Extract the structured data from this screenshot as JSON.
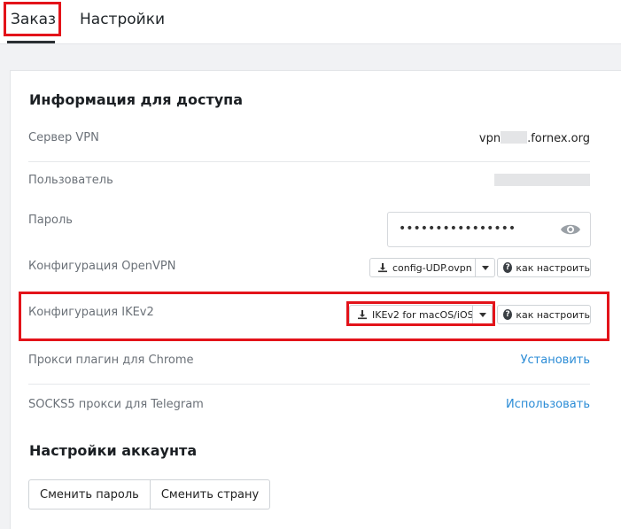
{
  "tabs": [
    {
      "label": "Заказ",
      "active": true
    },
    {
      "label": "Настройки",
      "active": false
    }
  ],
  "access": {
    "title": "Информация для доступа",
    "server": {
      "label": "Сервер VPN",
      "value_prefix": "vpn",
      "value_suffix": ".fornex.org"
    },
    "user": {
      "label": "Пользователь"
    },
    "password": {
      "label": "Пароль",
      "masked": "••••••••••••••••"
    },
    "openvpn": {
      "label": "Конфигурация OpenVPN",
      "file": "config-UDP.ovpn",
      "help": "как настроить"
    },
    "ikev2": {
      "label": "Конфигурация IKEv2",
      "file": "IKEv2 for macOS/iOS",
      "help": "как настроить"
    },
    "chrome": {
      "label": "Прокси плагин для Chrome",
      "action": "Установить"
    },
    "telegram": {
      "label": "SOCKS5 прокси для Telegram",
      "action": "Использовать"
    }
  },
  "account": {
    "title": "Настройки аккаунта",
    "change_password": "Сменить пароль",
    "change_country": "Сменить страну"
  },
  "colors": {
    "highlight": "#e3131a",
    "link": "#2b8cd6"
  }
}
